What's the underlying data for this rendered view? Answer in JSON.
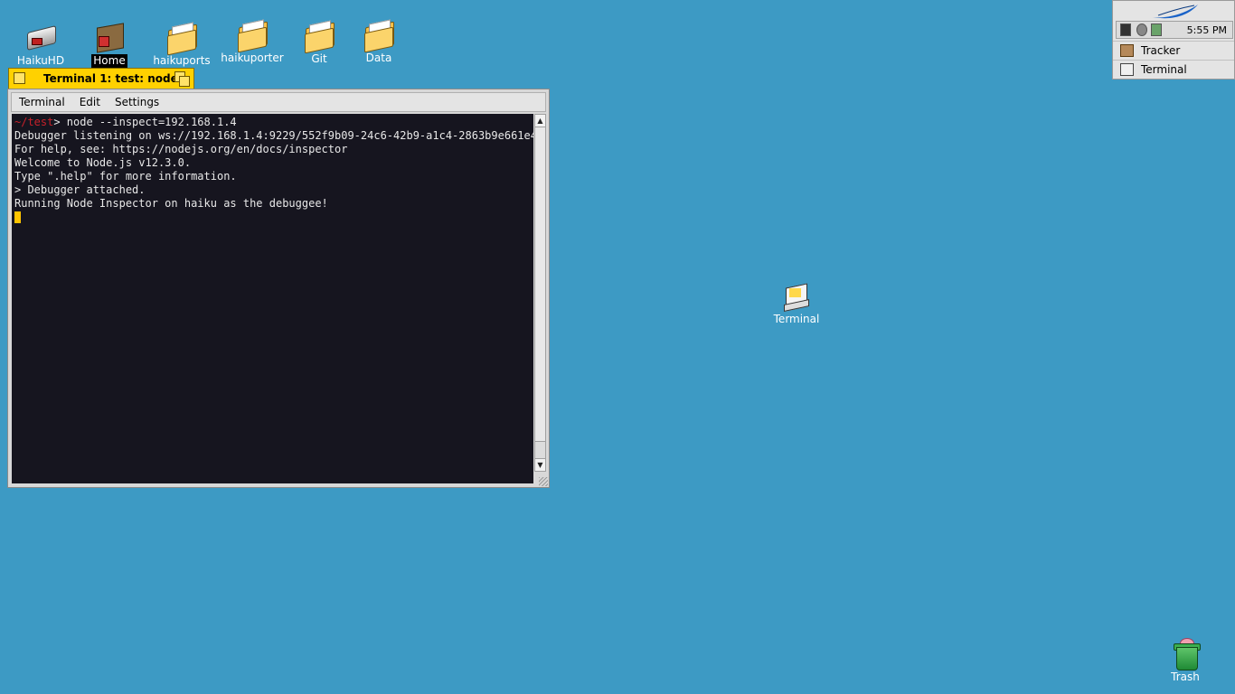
{
  "desktop": {
    "icons": [
      {
        "label": "HaikuHD",
        "type": "disk"
      },
      {
        "label": "Home",
        "type": "home",
        "selected": true
      },
      {
        "label": "haikuports",
        "type": "folder"
      },
      {
        "label": "haikuporter",
        "type": "folder"
      },
      {
        "label": "Git",
        "type": "folder"
      },
      {
        "label": "Data",
        "type": "folder"
      }
    ],
    "terminal_icon": {
      "label": "Terminal"
    },
    "trash": {
      "label": "Trash"
    }
  },
  "window": {
    "title": "Terminal 1: test: node",
    "menus": [
      "Terminal",
      "Edit",
      "Settings"
    ],
    "terminal": {
      "prompt_path": "~/test",
      "command": "> node --inspect=192.168.1.4",
      "output": [
        "Debugger listening on ws://192.168.1.4:9229/552f9b09-24c6-42b9-a1c4-2863b9e661e4",
        "For help, see: https://nodejs.org/en/docs/inspector",
        "Welcome to Node.js v12.3.0.",
        "Type \".help\" for more information.",
        "> Debugger attached.",
        "Running Node Inspector on haiku as the debuggee!"
      ]
    }
  },
  "deskbar": {
    "clock": "5:55 PM",
    "apps": [
      "Tracker",
      "Terminal"
    ]
  },
  "colors": {
    "desktop": "#3d9ac4",
    "tab": "#ffd100",
    "terminal_bg": "#16151f",
    "prompt_path": "#c8202a",
    "cursor": "#ffc400"
  }
}
